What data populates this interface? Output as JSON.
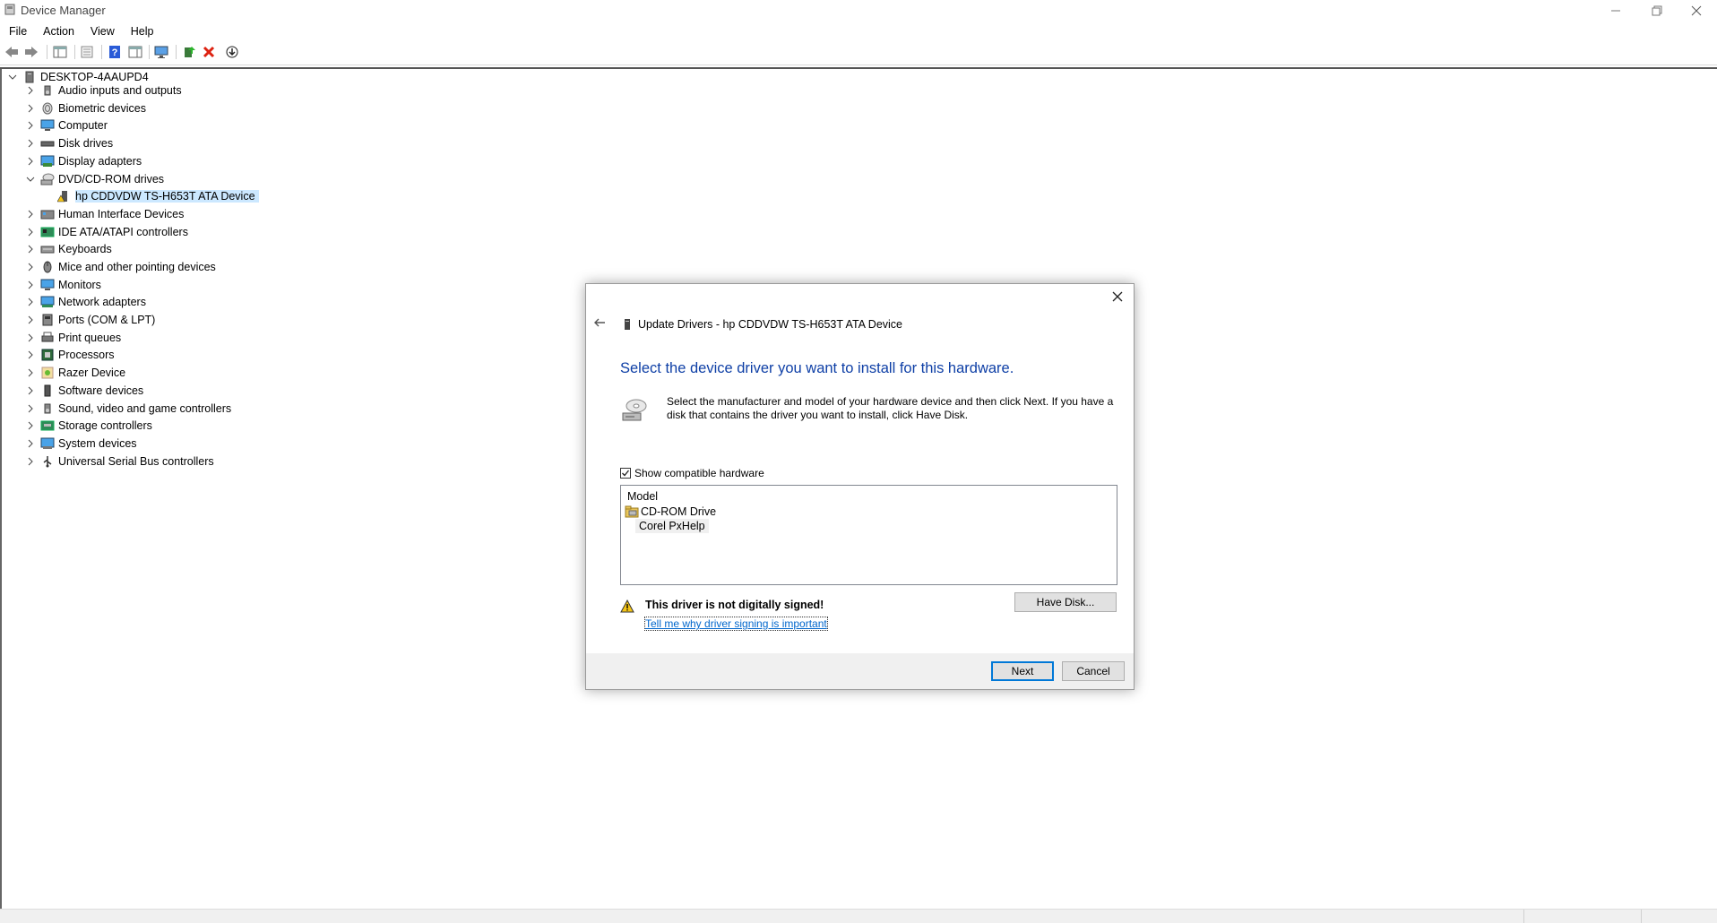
{
  "window": {
    "title": "Device Manager"
  },
  "menu": [
    "File",
    "Action",
    "View",
    "Help"
  ],
  "tree": {
    "root": "DESKTOP-4AAUPD4",
    "categories": [
      {
        "label": "Audio inputs and outputs",
        "icon": "speaker-icon"
      },
      {
        "label": "Biometric devices",
        "icon": "fingerprint-icon"
      },
      {
        "label": "Computer",
        "icon": "computer-icon"
      },
      {
        "label": "Disk drives",
        "icon": "disk-drive-icon"
      },
      {
        "label": "Display adapters",
        "icon": "display-adapter-icon"
      },
      {
        "label": "DVD/CD-ROM drives",
        "icon": "dvd-drive-icon"
      },
      {
        "label": "Human Interface Devices",
        "icon": "hid-icon"
      },
      {
        "label": "IDE ATA/ATAPI controllers",
        "icon": "ide-controller-icon"
      },
      {
        "label": "Keyboards",
        "icon": "keyboard-icon"
      },
      {
        "label": "Mice and other pointing devices",
        "icon": "mouse-icon"
      },
      {
        "label": "Monitors",
        "icon": "monitor-icon"
      },
      {
        "label": "Network adapters",
        "icon": "network-adapter-icon"
      },
      {
        "label": "Ports (COM & LPT)",
        "icon": "port-icon"
      },
      {
        "label": "Print queues",
        "icon": "printer-icon"
      },
      {
        "label": "Processors",
        "icon": "processor-icon"
      },
      {
        "label": "Razer Device",
        "icon": "razer-device-icon"
      },
      {
        "label": "Software devices",
        "icon": "software-device-icon"
      },
      {
        "label": "Sound, video and game controllers",
        "icon": "speaker-icon"
      },
      {
        "label": "Storage controllers",
        "icon": "storage-controller-icon"
      },
      {
        "label": "System devices",
        "icon": "system-device-icon"
      },
      {
        "label": "Universal Serial Bus controllers",
        "icon": "usb-icon"
      }
    ],
    "expanded_child": "hp CDDVDW TS-H653T ATA Device"
  },
  "dialog": {
    "header": "Update Drivers - hp CDDVDW TS-H653T ATA Device",
    "heading": "Select the device driver you want to install for this hardware.",
    "description": "Select the manufacturer and model of your hardware device and then click Next. If you have a disk that contains the driver you want to install, click Have Disk.",
    "show_compatible_label": "Show compatible hardware",
    "show_compatible_checked": true,
    "list_header": "Model",
    "list_items": [
      "CD-ROM Drive",
      "Corel PxHelp"
    ],
    "warning_text": "This driver is not digitally signed!",
    "link_text": "Tell me why driver signing is important",
    "have_disk_label": "Have Disk...",
    "next_label": "Next",
    "cancel_label": "Cancel"
  },
  "colors": {
    "heading_blue": "#0e3fa6",
    "selection": "#cce8ff",
    "link": "#0066cc",
    "default_button_border": "#0078d7"
  }
}
